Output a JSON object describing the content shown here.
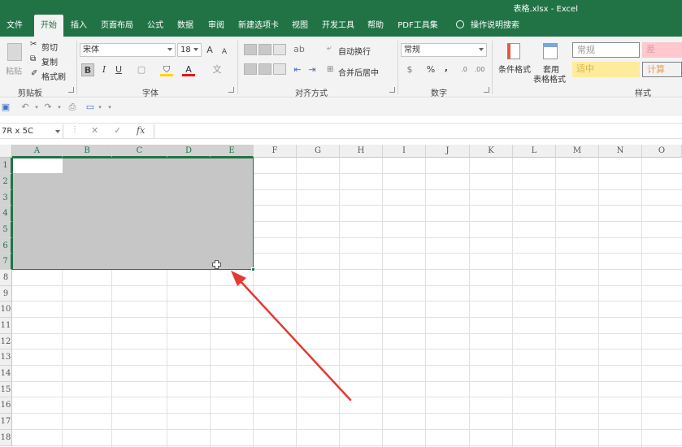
{
  "app": {
    "window_title": "表格.xlsx  -  Excel"
  },
  "tabs": [
    {
      "label": "文件"
    },
    {
      "label": "开始"
    },
    {
      "label": "插入"
    },
    {
      "label": "页面布局"
    },
    {
      "label": "公式"
    },
    {
      "label": "数据"
    },
    {
      "label": "审阅"
    },
    {
      "label": "新建选项卡"
    },
    {
      "label": "视图"
    },
    {
      "label": "开发工具"
    },
    {
      "label": "帮助"
    },
    {
      "label": "PDF工具集"
    },
    {
      "label": "操作说明搜索"
    }
  ],
  "ribbon": {
    "clipboard": {
      "paste": "粘贴",
      "cut": "剪切",
      "copy": "复制",
      "format_painter": "格式刷",
      "label": "剪贴板"
    },
    "font": {
      "name": "宋体",
      "size": "18",
      "bold": "B",
      "italic": "I",
      "underline": "U",
      "grow": "A",
      "shrink": "A",
      "color_letter": "A",
      "label": "字体"
    },
    "alignment": {
      "wrap": "自动换行",
      "merge": "合并后居中",
      "label": "对齐方式"
    },
    "number": {
      "format": "常规",
      "percent": "%",
      "comma": ",",
      "label": "数字"
    },
    "styles": {
      "conditional": "条件格式",
      "table_format_1": "套用",
      "table_format_2": "表格格式",
      "normal": "常规",
      "bad": "差",
      "neutral": "适中",
      "calc": "计算",
      "label": "样式"
    }
  },
  "formula_bar": {
    "name_box": "7R x 5C",
    "cancel": "✕",
    "enter": "✓",
    "fx": "fx",
    "value": ""
  },
  "sheet": {
    "columns": [
      "A",
      "B",
      "C",
      "D",
      "E",
      "F",
      "G",
      "H",
      "I",
      "J",
      "K",
      "L",
      "M",
      "N",
      "O"
    ],
    "rows": [
      "1",
      "2",
      "3",
      "4",
      "5",
      "6",
      "7",
      "8",
      "9",
      "10",
      "11",
      "12",
      "13",
      "14",
      "15",
      "16",
      "17",
      "18"
    ],
    "selected_range": "A1:E7"
  },
  "colors": {
    "excel_green": "#217346",
    "arrow_red": "#e53935",
    "selection_gray": "#c6c6c6"
  }
}
